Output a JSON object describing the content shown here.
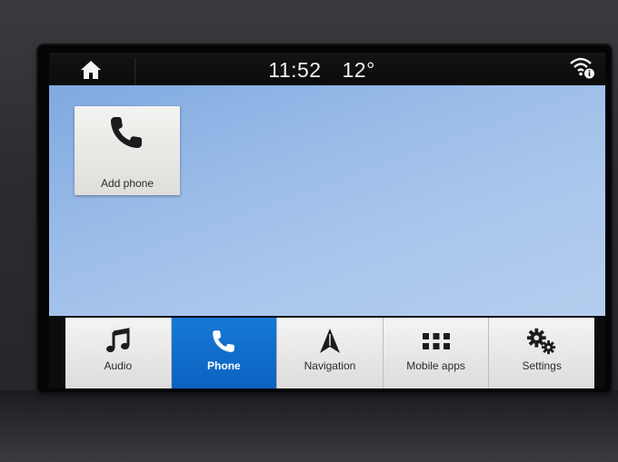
{
  "status_bar": {
    "time": "11:52",
    "temperature": "12°",
    "home_icon": "home-icon",
    "wifi_icon": "wifi-info-icon"
  },
  "home_screen": {
    "tiles": [
      {
        "label": "Add phone",
        "icon": "phone-icon"
      }
    ]
  },
  "bottom_nav": {
    "items": [
      {
        "label": "Audio",
        "icon": "music-note-icon",
        "active": false
      },
      {
        "label": "Phone",
        "icon": "phone-icon",
        "active": true
      },
      {
        "label": "Navigation",
        "icon": "navigation-arrow-icon",
        "active": false
      },
      {
        "label": "Mobile apps",
        "icon": "apps-grid-icon",
        "active": false
      },
      {
        "label": "Settings",
        "icon": "gears-icon",
        "active": false
      }
    ]
  },
  "colors": {
    "active_tab": "#1170d0",
    "wallpaper": "#9cbde9",
    "status_bar": "#0b0b0c"
  }
}
